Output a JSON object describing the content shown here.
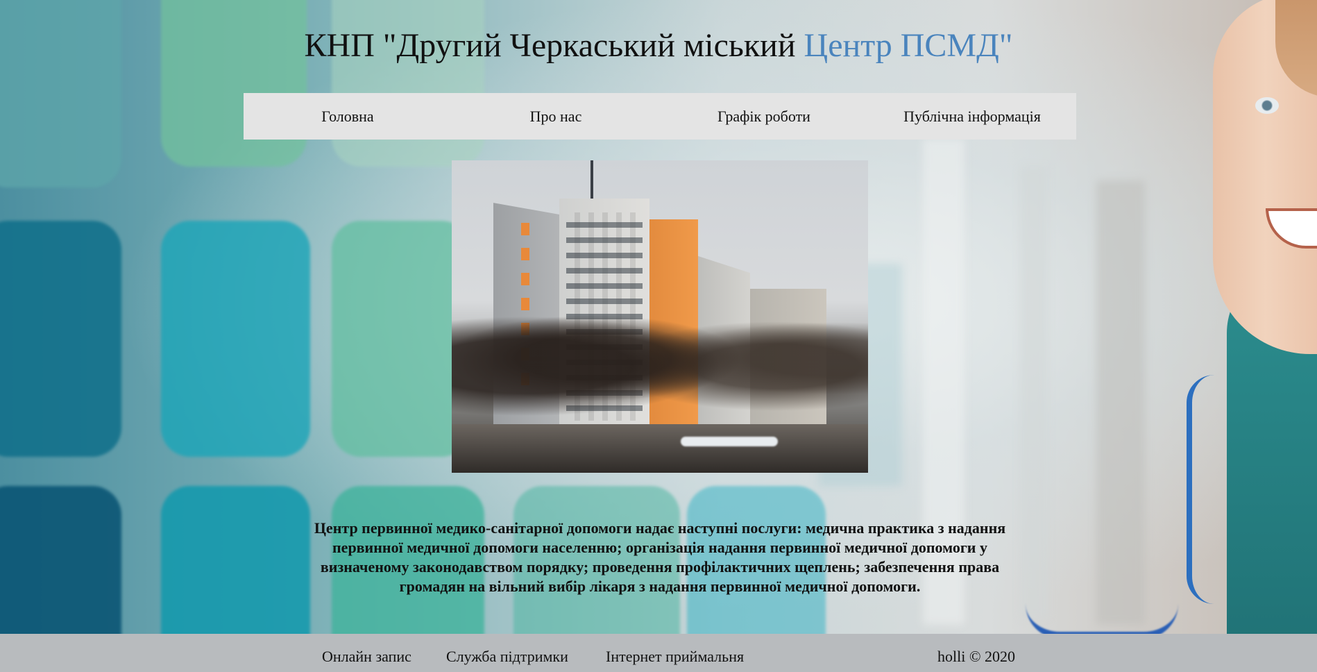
{
  "header": {
    "title_main": "КНП \"Другий Черкаський міський ",
    "title_accent": "Центр ПСМД\""
  },
  "nav": {
    "items": [
      {
        "label": "Головна"
      },
      {
        "label": "Про нас"
      },
      {
        "label": "Графік роботи"
      },
      {
        "label": "Публічна інформація"
      }
    ]
  },
  "main": {
    "description": "Центр первинної медико-санітарної допомоги надає наступні послуги: медична практика з надання первинної медичної допомоги населенню; організація надання первинної медичної допомоги у визначеному законодавством порядку; проведення профілактичних щеплень; забезпечення права громадян на вільний вибір лікаря з надання первинної медичної допомоги."
  },
  "footer": {
    "links": [
      {
        "label": "Онлайн запис"
      },
      {
        "label": "Служба підтримки"
      },
      {
        "label": "Інтернет приймальня"
      }
    ],
    "copyright": "holli © 2020"
  },
  "colors": {
    "title_accent": "#4a84bd",
    "nav_background": "#e4e4e4",
    "footer_background": "#b8bbbe"
  }
}
